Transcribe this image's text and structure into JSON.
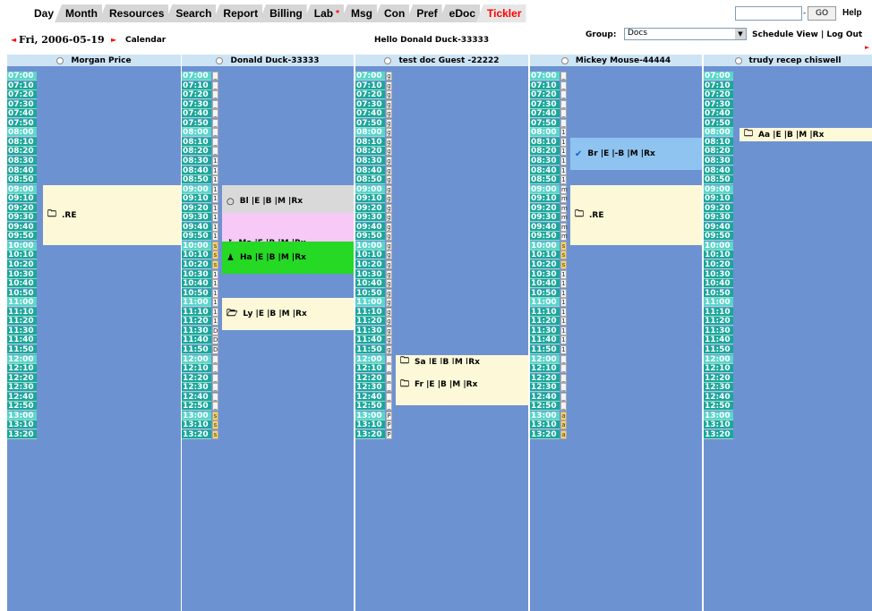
{
  "tabs": [
    {
      "label": "Day",
      "active": true
    },
    {
      "label": "Month"
    },
    {
      "label": "Resources"
    },
    {
      "label": "Search"
    },
    {
      "label": "Report"
    },
    {
      "label": "Billing"
    },
    {
      "label": "Lab",
      "flag": "*"
    },
    {
      "label": "Msg"
    },
    {
      "label": "Con"
    },
    {
      "label": "Pref"
    },
    {
      "label": "eDoc"
    },
    {
      "label": "Tickler",
      "alert": true
    }
  ],
  "search": {
    "value": "",
    "go_label": "GO",
    "separator": "-"
  },
  "help_label": "Help",
  "datebar": {
    "prev_arrow": "◄",
    "date": "Fri, 2006-05-19",
    "next_arrow": "►",
    "calendar_label": "Calendar",
    "hello": "Hello Donald Duck-33333",
    "group_label": "Group:",
    "group_value": "Docs",
    "schedule_links": "Schedule View | Log Out"
  },
  "providers": [
    {
      "name": "Morgan Price"
    },
    {
      "name": "Donald Duck-33333"
    },
    {
      "name": "test doc Guest -22222"
    },
    {
      "name": "Mickey Mouse-44444"
    },
    {
      "name": "trudy recep chiswell"
    }
  ],
  "times": [
    "07:00",
    "07:10",
    "07:20",
    "07:30",
    "07:40",
    "07:50",
    "08:00",
    "08:10",
    "08:20",
    "08:30",
    "08:40",
    "08:50",
    "09:00",
    "09:10",
    "09:20",
    "09:30",
    "09:40",
    "09:50",
    "10:00",
    "10:10",
    "10:20",
    "10:30",
    "10:40",
    "10:50",
    "11:00",
    "11:10",
    "11:20",
    "11:30",
    "11:40",
    "11:50",
    "12:00",
    "12:10",
    "12:20",
    "12:30",
    "12:40",
    "12:50",
    "13:00",
    "13:10",
    "13:20"
  ],
  "template_codes": {
    "col2": [
      "_",
      "_",
      "_",
      "_",
      "_",
      "_",
      "_",
      "_",
      "_",
      "1",
      "1",
      "1",
      "1",
      "1",
      "1",
      "1",
      "1",
      "1",
      "s",
      "s",
      "s",
      "1",
      "1",
      "1",
      "1",
      "1",
      "1",
      "D",
      "D",
      "D",
      "_",
      "_",
      "_",
      "_",
      "_",
      "_",
      "s",
      "s",
      "s"
    ],
    "col3": [
      "g",
      "g",
      "g",
      "g",
      "g",
      "g",
      "g",
      "g",
      "g",
      "g",
      "g",
      "g",
      "g",
      "g",
      "g",
      "g",
      "g",
      "g",
      "g",
      "g",
      "g",
      "g",
      "g",
      "g",
      "g",
      "g",
      "g",
      "g",
      "g",
      "g",
      "_",
      "_",
      "_",
      "_",
      "_",
      "_",
      "P",
      "P",
      "P"
    ],
    "col4": [
      "_",
      "_",
      "_",
      "_",
      "_",
      "_",
      "1",
      "1",
      "1",
      "1",
      "1",
      "1",
      "m",
      "m",
      "m",
      "m",
      "m",
      "m",
      "s",
      "s",
      "s",
      "1",
      "1",
      "1",
      "1",
      "1",
      "1",
      "1",
      "1",
      "1",
      "_",
      "_",
      "_",
      "_",
      "_",
      "_",
      "a",
      "a",
      "a"
    ]
  },
  "appointments": [
    {
      "col": 0,
      "label": ".RE",
      "icon": "folder-icon",
      "icon_glyph": "🗀",
      "color": "#fdf8d8",
      "start": 12,
      "slots": 6
    },
    {
      "col": 1,
      "label": "Bl |E |B |M |Rx",
      "icon": "circle-icon",
      "icon_glyph": "○",
      "color": "#d9d9d9",
      "start": 12,
      "slots": 3
    },
    {
      "col": 1,
      "label": "Ma |E |B |M |Rx",
      "icon": "key-icon",
      "icon_glyph": "⚷",
      "color": "#f6c9f6",
      "start": 15,
      "slots": 6
    },
    {
      "col": 1,
      "label": "Ha |E |B |M |Rx",
      "icon": "person-icon",
      "icon_glyph": "♟",
      "color": "#25d925",
      "start": 18,
      "slots": 3
    },
    {
      "col": 1,
      "label": "Ly |E |B |M |Rx",
      "icon": "open-folder-icon",
      "icon_glyph": "🗁",
      "color": "#fdf8d8",
      "start": 24,
      "slots": 3
    },
    {
      "col": 2,
      "label": "Sa |E |B |M |Rx",
      "icon": "folder-icon",
      "icon_glyph": "🗀",
      "color": "#fdf8d8",
      "start": 30,
      "slots": 1
    },
    {
      "col": 2,
      "label": "Fr |E |B |M |Rx",
      "icon": "folder-icon",
      "icon_glyph": "🗀",
      "color": "#fdf8d8",
      "start": 31,
      "slots": 4
    },
    {
      "col": 3,
      "label": "Br |E |-B |M |Rx",
      "icon": "checkmark-icon",
      "icon_glyph": "✔",
      "color": "#8fc3f0",
      "start": 7,
      "slots": 3
    },
    {
      "col": 3,
      "label": ".RE",
      "icon": "folder-icon",
      "icon_glyph": "🗀",
      "color": "#fdf8d8",
      "start": 12,
      "slots": 6
    },
    {
      "col": 4,
      "label": "Aa |E |B |M |Rx",
      "icon": "folder-icon",
      "icon_glyph": "🗀",
      "color": "#fdf8d8",
      "start": 6,
      "slots": 1
    }
  ]
}
